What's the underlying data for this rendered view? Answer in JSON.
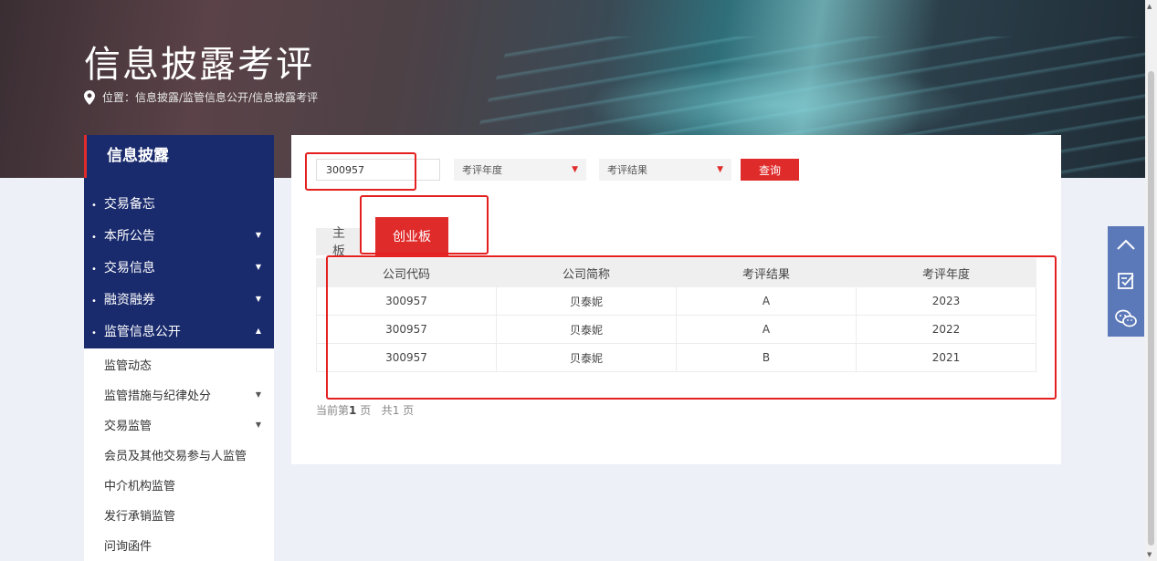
{
  "header": {
    "title": "信息披露考评",
    "breadcrumb": "位置：信息披露/监管信息公开/信息披露考评"
  },
  "sidebar": {
    "title": "信息披露",
    "items": [
      {
        "label": "交易备忘",
        "has_caret": false
      },
      {
        "label": "本所公告",
        "has_caret": true
      },
      {
        "label": "交易信息",
        "has_caret": true
      },
      {
        "label": "融资融券",
        "has_caret": true
      },
      {
        "label": "监管信息公开",
        "has_caret": true,
        "expanded": true
      }
    ],
    "sub_items": [
      {
        "label": "监管动态",
        "has_caret": false
      },
      {
        "label": "监管措施与纪律处分",
        "has_caret": true
      },
      {
        "label": "交易监管",
        "has_caret": true
      },
      {
        "label": "会员及其他交易参与人监管",
        "has_caret": false
      },
      {
        "label": "中介机构监管",
        "has_caret": false
      },
      {
        "label": "发行承销监管",
        "has_caret": false
      },
      {
        "label": "问询函件",
        "has_caret": false
      }
    ]
  },
  "search": {
    "code_value": "300957",
    "year_select": "考评年度",
    "result_select": "考评结果",
    "query_label": "查询"
  },
  "tabs": [
    {
      "label": "主板",
      "active": false
    },
    {
      "label": "创业板",
      "active": true
    }
  ],
  "table": {
    "headers": [
      "公司代码",
      "公司简称",
      "考评结果",
      "考评年度"
    ],
    "rows": [
      [
        "300957",
        "贝泰妮",
        "A",
        "2023"
      ],
      [
        "300957",
        "贝泰妮",
        "A",
        "2022"
      ],
      [
        "300957",
        "贝泰妮",
        "B",
        "2021"
      ]
    ]
  },
  "pager": {
    "prefix": "当前第",
    "current": "1",
    "page_word": "页",
    "total_prefix": "共",
    "total": "1",
    "total_suffix": "页"
  },
  "float_buttons": [
    "chevron-up-icon",
    "edit-icon",
    "wechat-icon"
  ],
  "colors": {
    "accent_red": "#e02b2b",
    "nav_blue": "#1a2b6d",
    "float_blue": "#5b78b8"
  }
}
